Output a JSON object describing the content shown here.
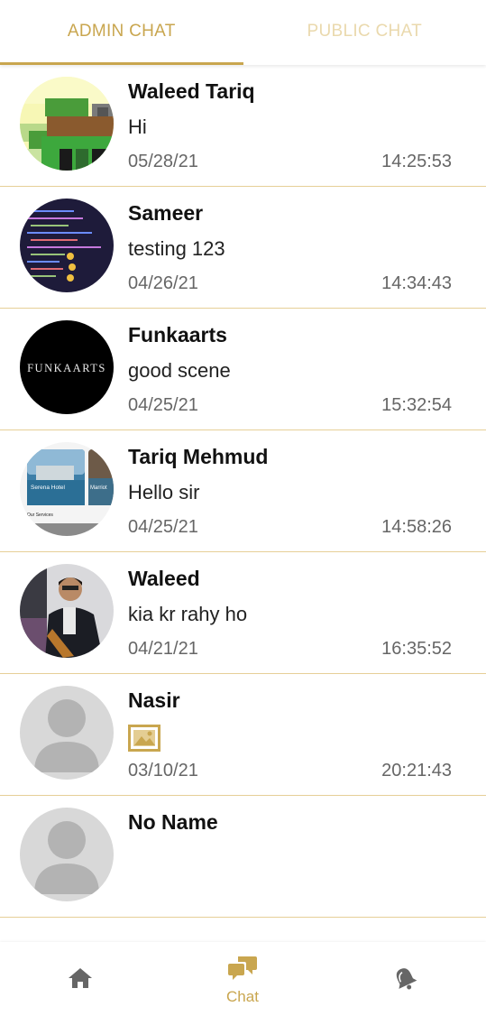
{
  "tabs": [
    {
      "label": "ADMIN CHAT",
      "active": true
    },
    {
      "label": "PUBLIC CHAT",
      "active": false
    }
  ],
  "chats": [
    {
      "name": "Waleed Tariq",
      "message": "Hi",
      "date": "05/28/21",
      "time": "14:25:53",
      "avatar": "pixel-art-avatar"
    },
    {
      "name": "Sameer",
      "message": "testing 123",
      "date": "04/26/21",
      "time": "14:34:43",
      "avatar": "code-screenshot-avatar"
    },
    {
      "name": "Funkaarts",
      "message": "good scene",
      "date": "04/25/21",
      "time": "15:32:54",
      "avatar": "funkaarts-logo-avatar",
      "avatar_text": "FUNKAARTS"
    },
    {
      "name": "Tariq Mehmud",
      "message": "Hello sir",
      "date": "04/25/21",
      "time": "14:58:26",
      "avatar": "hotel-app-avatar",
      "avatar_texts": [
        "Serena Hotel",
        "Marriot",
        "Our Services"
      ]
    },
    {
      "name": "Waleed",
      "message": "kia kr rahy ho",
      "date": "04/21/21",
      "time": "16:35:52",
      "avatar": "person-photo-avatar"
    },
    {
      "name": "Nasir",
      "message": "",
      "message_icon": "image-icon",
      "date": "03/10/21",
      "time": "20:21:43",
      "avatar": "default-person-avatar"
    },
    {
      "name": "No Name",
      "message": "",
      "date": "",
      "time": "",
      "avatar": "default-person-avatar"
    }
  ],
  "bottom_nav": {
    "items": [
      {
        "icon": "home-icon",
        "label": ""
      },
      {
        "icon": "chat-icon",
        "label": "Chat",
        "active": true
      },
      {
        "icon": "bell-icon",
        "label": ""
      }
    ]
  },
  "colors": {
    "accent": "#c9a64f",
    "accent_light": "#ead9ad",
    "divider": "#e6cf97"
  }
}
